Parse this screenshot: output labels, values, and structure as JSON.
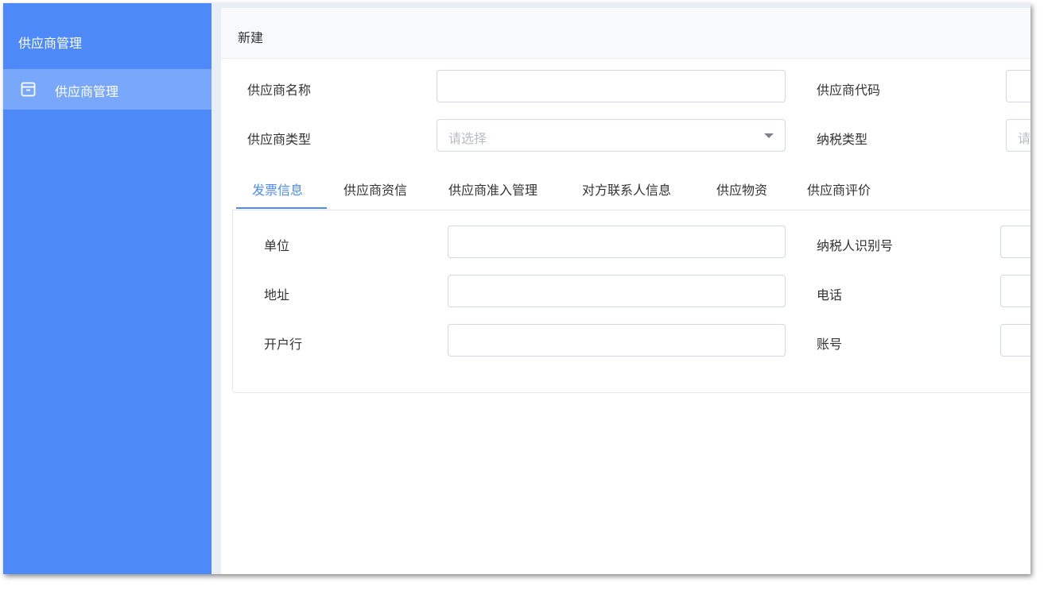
{
  "sidebar": {
    "title": "供应商管理",
    "items": [
      {
        "label": "供应商管理",
        "icon": "archive-icon",
        "active": true
      }
    ]
  },
  "header": {
    "title": "新建"
  },
  "form": {
    "supplier_name": {
      "label": "供应商名称",
      "value": ""
    },
    "supplier_code": {
      "label": "供应商代码",
      "value": ""
    },
    "supplier_type": {
      "label": "供应商类型",
      "placeholder": "请选择"
    },
    "tax_type": {
      "label": "纳税类型",
      "placeholder": "请"
    }
  },
  "tabs": [
    {
      "label": "发票信息",
      "active": true
    },
    {
      "label": "供应商资信"
    },
    {
      "label": "供应商准入管理"
    },
    {
      "label": "对方联系人信息"
    },
    {
      "label": "供应物资"
    },
    {
      "label": "供应商评价"
    }
  ],
  "invoice": {
    "unit": {
      "label": "单位",
      "value": ""
    },
    "taxpayer_id": {
      "label": "纳税人识别号",
      "value": ""
    },
    "address": {
      "label": "地址",
      "value": ""
    },
    "phone": {
      "label": "电话",
      "value": ""
    },
    "bank": {
      "label": "开户行",
      "value": ""
    },
    "account": {
      "label": "账号",
      "value": ""
    }
  },
  "colors": {
    "sidebar_bg": "#4e8af7",
    "sidebar_active": "#79a8fb",
    "accent": "#4e8af7"
  }
}
